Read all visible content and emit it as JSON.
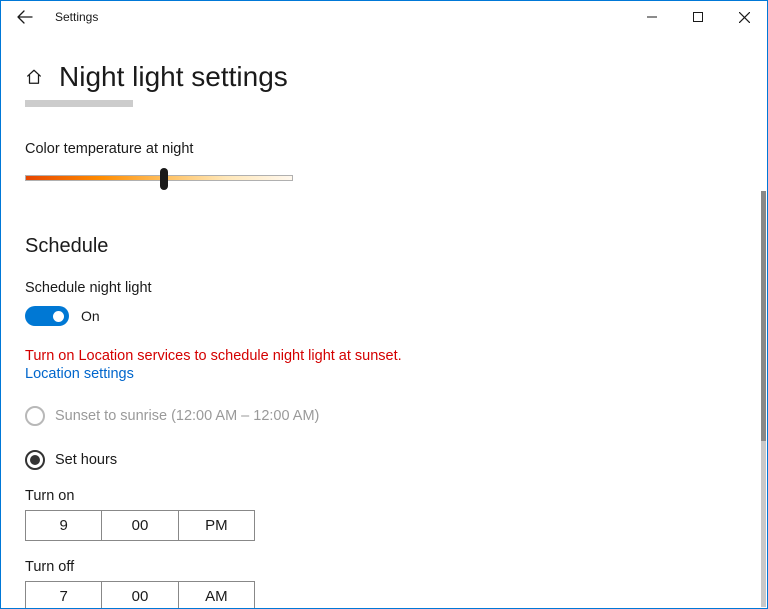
{
  "window": {
    "title": "Settings"
  },
  "page": {
    "title": "Night light settings"
  },
  "color_temp": {
    "label": "Color temperature at night",
    "value_pct": 52
  },
  "schedule": {
    "heading": "Schedule",
    "toggle_label": "Schedule night light",
    "toggle_state": "On",
    "warning": "Turn on Location services to schedule night light at sunset.",
    "link": "Location settings",
    "option_sunset": "Sunset to sunrise (12:00 AM – 12:00 AM)",
    "option_sethours": "Set hours",
    "turn_on": {
      "label": "Turn on",
      "hour": "9",
      "minute": "00",
      "ampm": "PM"
    },
    "turn_off": {
      "label": "Turn off",
      "hour": "7",
      "minute": "00",
      "ampm": "AM"
    }
  }
}
